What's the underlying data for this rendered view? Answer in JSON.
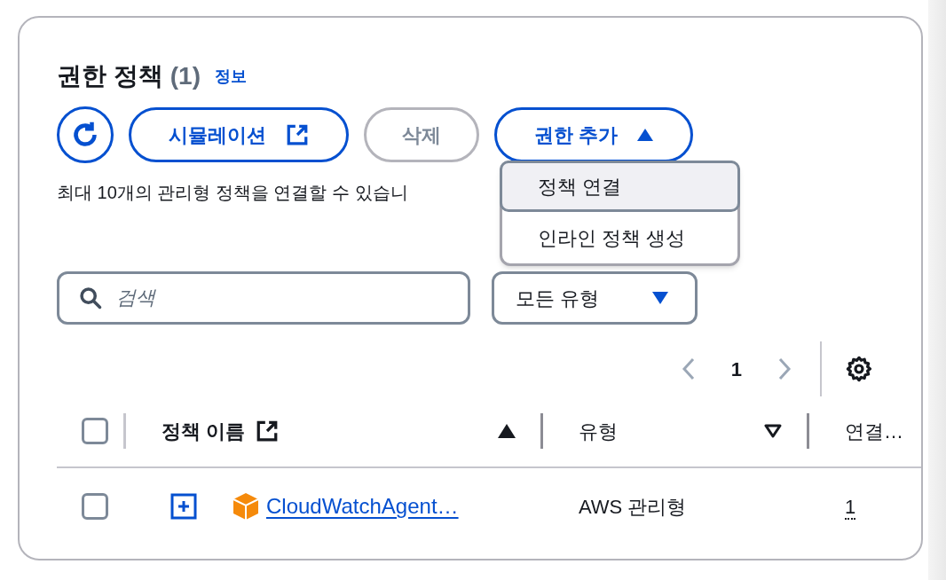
{
  "section": {
    "title": "권한 정책",
    "count": "(1)",
    "info_link": "정보"
  },
  "toolbar": {
    "buttons": [
      {
        "kind": "refresh",
        "disabled": false
      },
      {
        "kind": "external",
        "label": "시뮬레이션",
        "disabled": false
      },
      {
        "kind": "text",
        "label": "삭제",
        "disabled": true
      },
      {
        "kind": "dropdown",
        "label": "권한 추가",
        "disabled": false,
        "expanded": true
      }
    ]
  },
  "description": "최대 10개의 관리형 정책을 연결할 수 있습니",
  "menu": {
    "items": [
      {
        "label": "정책 연결",
        "selected": true
      },
      {
        "label": "인라인 정책 생성",
        "selected": false
      }
    ]
  },
  "search": {
    "placeholder": "검색"
  },
  "type_filter": {
    "value": "모든 유형"
  },
  "pagination": {
    "page": "1"
  },
  "table": {
    "select_all": {
      "checked": false
    },
    "columns": [
      {
        "label": "정책 이름",
        "external": true,
        "sorted": true
      },
      {
        "label": "유형",
        "external": false,
        "sorted": false
      },
      {
        "label": "연결…"
      }
    ],
    "rows": [
      {
        "checked": false,
        "expanded": false,
        "name": "CloudWatchAgent…",
        "type": "AWS 관리형",
        "attached": "1"
      }
    ]
  }
}
